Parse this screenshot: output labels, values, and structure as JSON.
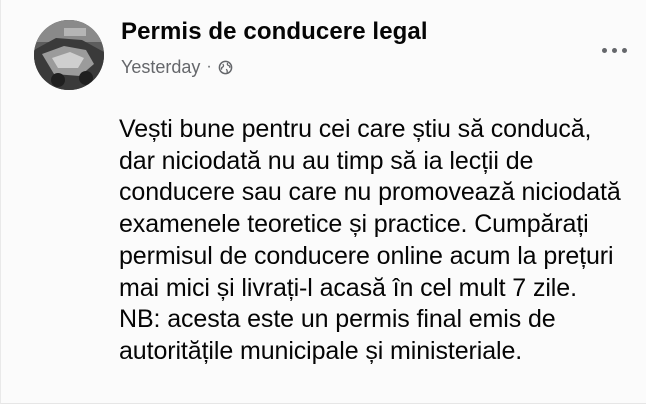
{
  "post": {
    "author": "Permis de conducere legal",
    "timestamp": "Yesterday",
    "separator": "·",
    "privacy_icon": "globe-icon",
    "menu_icon": "more-horizontal-icon",
    "text": "Vești bune pentru cei care știu să conducă,\ndar niciodată nu au timp să ia lecții de\nconducere sau care nu promovează niciodată\nexamenele teoretice și practice.  Cumpărați\npermisul de conducere online acum la prețuri\nmai mici și livrați-l acasă în cel mult 7 zile.\n NB: acesta este un permis final emis de\nautoritățile municipale și ministeriale."
  },
  "colors": {
    "text": "#050505",
    "meta": "#65676b",
    "background": "#fbfbfb"
  }
}
